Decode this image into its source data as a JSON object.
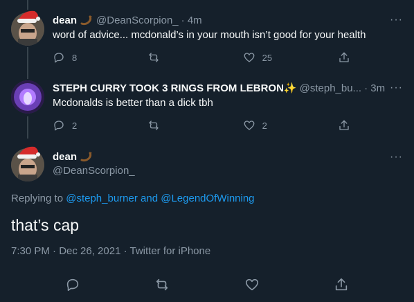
{
  "tweets": [
    {
      "name": "dean",
      "handle": "@DeanScorpion_",
      "time": "· 4m",
      "text": "word of advice... mcdonald’s in your mouth isn’t good for your health",
      "replies": "8",
      "retweets": "",
      "likes": "25"
    },
    {
      "name": "STEPH CURRY TOOK 3 RINGS FROM LEBRON✨",
      "handle": "@steph_bu...",
      "time": "· 3m",
      "text": "Mcdonalds is better than a dick tbh",
      "replies": "2",
      "retweets": "",
      "likes": "2"
    }
  ],
  "focus": {
    "name": "dean",
    "handle": "@DeanScorpion_",
    "replying_prefix": "Replying to",
    "replying_user1": "@steph_burner",
    "replying_and": "and",
    "replying_user2": "@LegendOfWinning",
    "text": "that’s cap",
    "timestamp": "7:30 PM · Dec 26, 2021 · Twitter for iPhone"
  },
  "more_glyph": "···",
  "colors": {
    "background": "#15202b",
    "link": "#1d9bf0",
    "muted": "#8b98a5"
  },
  "icons": [
    "santa-hat-icon",
    "scorpion-icon",
    "sparkles-icon",
    "reply-icon",
    "retweet-icon",
    "like-icon",
    "share-icon",
    "more-icon"
  ]
}
